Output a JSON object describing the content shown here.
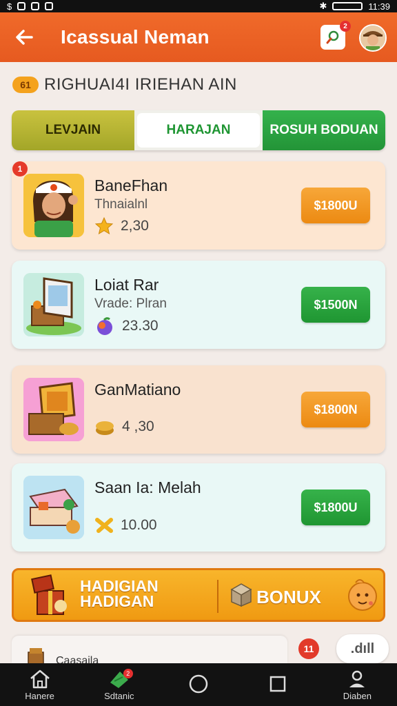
{
  "status_bar": {
    "left": "$",
    "time": "11:39"
  },
  "app_bar": {
    "back_icon": "arrow-left-icon",
    "title": "Icassual Neman",
    "search_badge": "2"
  },
  "subheader": {
    "badge": "61",
    "text": "RIGHUAI4I IRIEHAN AIN"
  },
  "tabs": [
    {
      "label": "LEVJAIN"
    },
    {
      "label": "HARAJAN"
    },
    {
      "label": "ROSUH BODUAN"
    }
  ],
  "cards_badge": "1",
  "cards": [
    {
      "name": "BaneFhan",
      "subtitle": "Thnaialnl",
      "meta": "2,30",
      "price": "$1800U",
      "price_color": "#ec8a12"
    },
    {
      "name": "Loiat Rar",
      "subtitle": "Vrade: Plran",
      "meta": "23.30",
      "price": "$1500N",
      "price_color": "#1f9632"
    },
    {
      "name": "GanMatiano",
      "subtitle": "",
      "meta": "4 ,30",
      "price": "$1800N",
      "price_color": "#ec8a12"
    },
    {
      "name": "Saan Ia: Melah",
      "subtitle": "",
      "meta": "10.00",
      "price": "$1800U",
      "price_color": "#1f9632"
    }
  ],
  "banner": {
    "line1": "HADIGIAN",
    "line2": "HADIGAN",
    "bonus": "BONUX"
  },
  "partial_row": {
    "text": "Caasaila"
  },
  "notif_dot": "11",
  "pill": ".dıll",
  "bottom_nav": [
    {
      "label": "Hanere",
      "icon": "home-icon"
    },
    {
      "label": "Sdtanic",
      "icon": "leaf-icon",
      "badge": "2"
    },
    {
      "label": "",
      "icon": "circle-icon"
    },
    {
      "label": "",
      "icon": "square-icon"
    },
    {
      "label": "Diaben",
      "icon": "person-icon"
    }
  ]
}
